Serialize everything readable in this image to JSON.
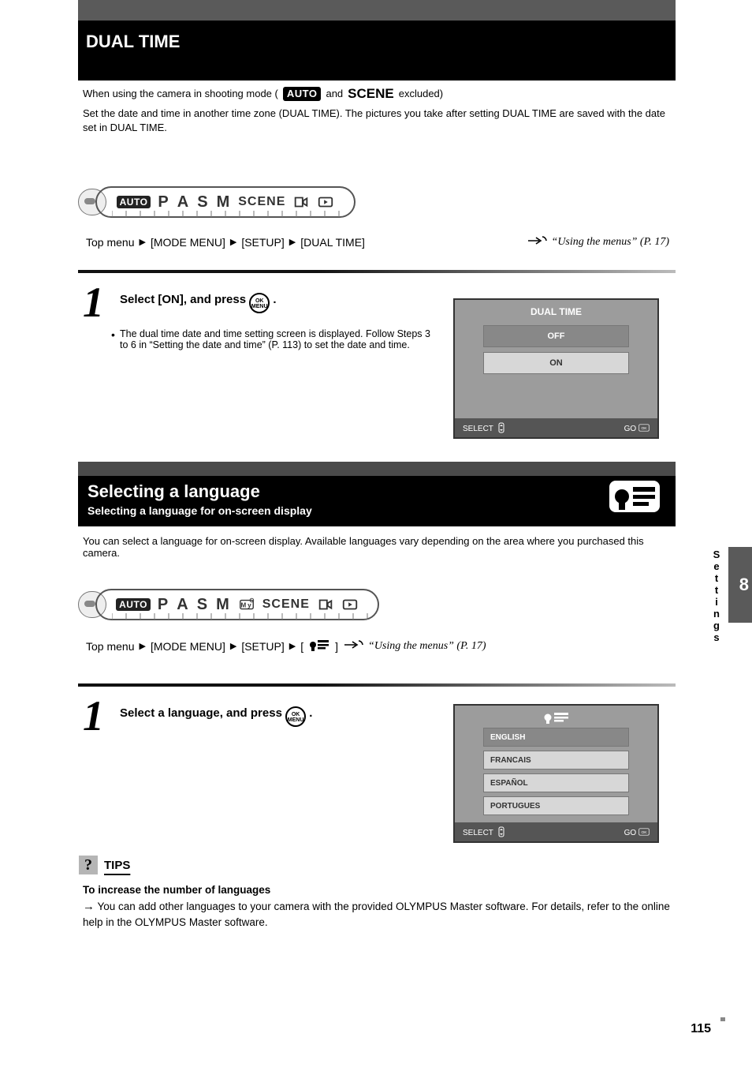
{
  "header1": {
    "title": "DUAL TIME",
    "subtitle_prefix": "When using the camera in shooting mode (",
    "subtitle_mid": " and ",
    "subtitle_suffix": " excluded)",
    "body": "Set the date and time in another time zone (DUAL TIME). The pictures you take after setting DUAL TIME are saved with the date set in DUAL TIME."
  },
  "dial1": {
    "modes": [
      "AUTO",
      "P",
      "A",
      "S",
      "M",
      "SCENE"
    ]
  },
  "breadcrumb1": {
    "items": [
      "Top menu",
      "[MODE MENU]",
      "[SETUP]",
      "[DUAL TIME]"
    ],
    "ref": "“Using the menus” (P. 17)"
  },
  "step1": {
    "num": "1",
    "text_before": "Select [ON], and press ",
    "text_after": ".",
    "bullet": "The dual time date and time setting screen is displayed. Follow Steps 3 to 6 in “Setting the date and time” (P. 113) to set the date and time."
  },
  "lcd1": {
    "title": "DUAL TIME",
    "options": [
      "OFF",
      "ON"
    ],
    "foot_left": "SELECT",
    "foot_right": "GO",
    "foot_right_label": "OK"
  },
  "header2": {
    "title": "Selecting a language",
    "subtitle": "Selecting a language for on-screen display"
  },
  "sec2sub": "You can select a language for on-screen display. Available languages vary depending on the area where you purchased this camera.",
  "breadcrumb2": {
    "items": [
      "Top menu",
      "[MODE MENU]",
      "[SETUP]",
      "[",
      "]"
    ],
    "ref": "“Using the menus” (P. 17)"
  },
  "step2": {
    "num": "1",
    "text_before": "Select a language, and press ",
    "text_after": "."
  },
  "lcd2": {
    "options": [
      "ENGLISH",
      "FRANCAIS",
      "ESPAÑOL",
      "PORTUGUES"
    ],
    "foot_left": "SELECT",
    "foot_right": "GO",
    "foot_right_label": "OK"
  },
  "tips": {
    "label": "TIPS",
    "bold": "To increase the number of languages",
    "arrow_line": "You can add other languages to your camera with the provided OLYMPUS Master software. For details, refer to the online help in the OLYMPUS Master software."
  },
  "side": {
    "chapter_vert": "Settings",
    "chapter_num": "8",
    "page": "115"
  }
}
